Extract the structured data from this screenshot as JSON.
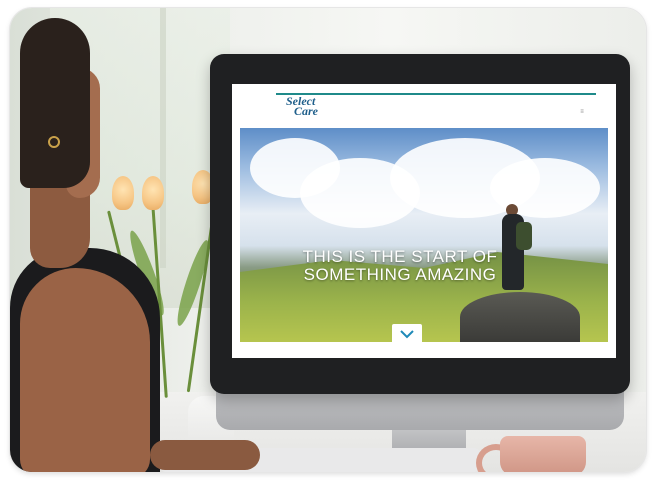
{
  "website": {
    "logo": {
      "line1": "Select",
      "line2": "Care"
    },
    "tagline": "",
    "hero": {
      "headline": [
        "THIS IS THE START OF",
        "SOMETHING AMAZING"
      ],
      "scroll_icon": "chevron-down-icon"
    }
  },
  "colors": {
    "brand_teal": "#1f8a8a",
    "logo_blue": "#1f5f8b",
    "accent_red": "#c0392b",
    "scroll_icon_blue": "#1f8ab8"
  }
}
